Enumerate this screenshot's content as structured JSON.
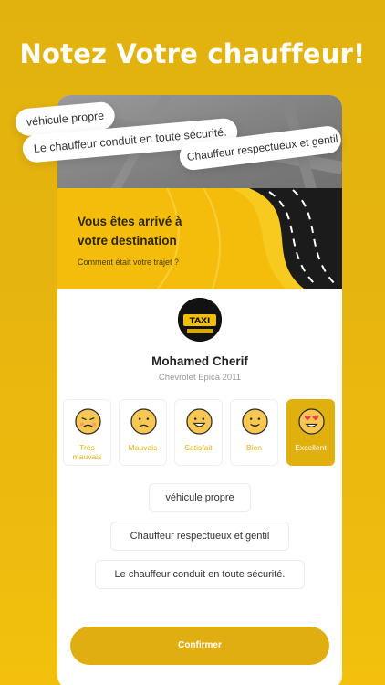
{
  "headline": "Notez Votre chauffeur!",
  "bubbles": [
    "véhicule propre",
    "Le chauffeur conduit en toute sécurité.",
    "Chauffeur respectueux et gentil"
  ],
  "arrival": {
    "title": "Vous êtes arrivé à votre destination",
    "subtitle": "Comment était votre trajet ?"
  },
  "driver": {
    "name": "Mohamed Cherif",
    "car": "Chevrolet Epica 2011",
    "avatar_sign": "TAXI"
  },
  "ratings": [
    {
      "label": "Très mauvais",
      "icon": "angry-face-icon",
      "selected": false
    },
    {
      "label": "Mauvais",
      "icon": "sad-face-icon",
      "selected": false
    },
    {
      "label": "Satisfait",
      "icon": "happy-face-icon",
      "selected": false
    },
    {
      "label": "Bien",
      "icon": "smile-face-icon",
      "selected": false
    },
    {
      "label": "Excellent",
      "icon": "heart-eyes-face-icon",
      "selected": true
    }
  ],
  "chips": [
    "véhicule propre",
    "Chauffeur respectueux et gentil",
    "Le chauffeur conduit en toute sécurité."
  ],
  "confirm_label": "Confirmer",
  "colors": {
    "brand": "#e6b40f",
    "selected": "#e0b00f",
    "label": "#e3b315"
  }
}
